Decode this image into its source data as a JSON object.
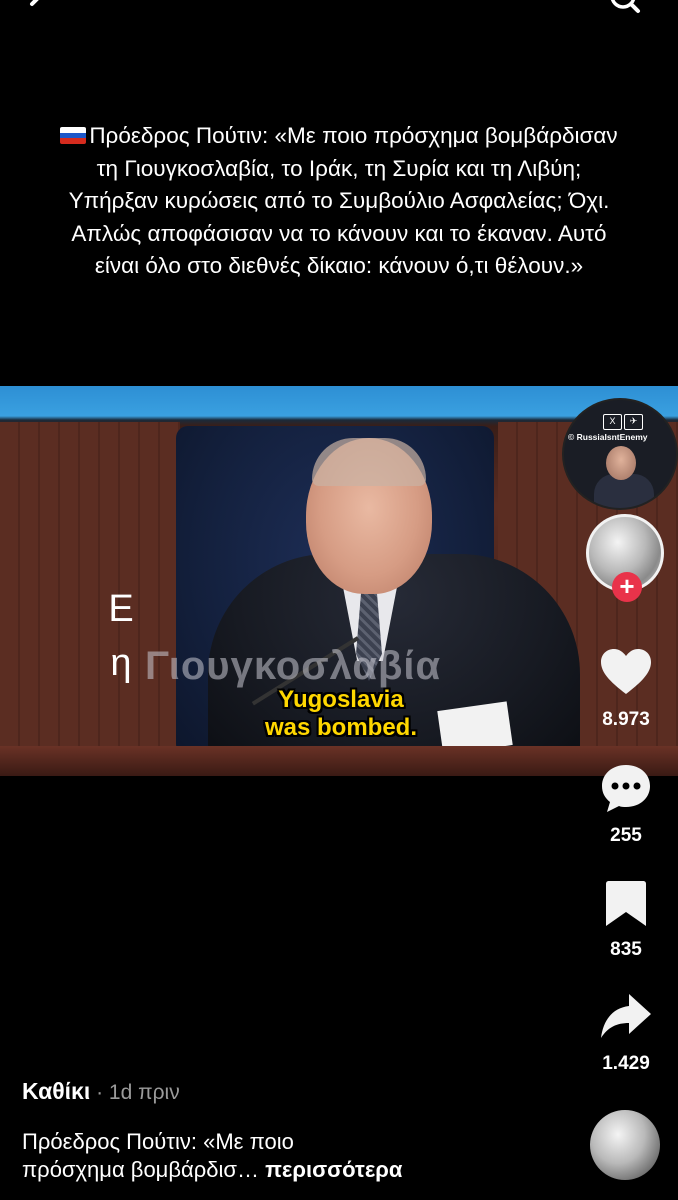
{
  "caption": {
    "flag_colors": [
      "#ffffff",
      "#1c57c9",
      "#d52b1e"
    ],
    "lines": [
      "Πρόεδρος Πούτιν: «Με ποιο πρόσχημα βομβάρδισαν",
      "τη Γιουγκοσλαβία, το Ιράκ, τη Συρία και τη Λιβύη;",
      "Υπήρξαν κυρώσεις από το Συμβούλιο Ασφαλείας; Όχι.",
      "Απλώς αποφάσισαν να το κάνουν και το έκαναν. Αυτό",
      "είναι όλο στο διεθνές δίκαιο: κάνουν ό,τι θέλουν.»"
    ]
  },
  "video": {
    "watermark": "Γιουγκοσλαβία",
    "side_letters": [
      "Ε",
      "η"
    ],
    "subtitle_line1": "Yugoslavia",
    "subtitle_line2": "was bombed.",
    "subtitle_color": "#ffd700"
  },
  "inset": {
    "logos": [
      "X",
      "✈"
    ],
    "handle": "© RussiaIsntEnemy"
  },
  "rail": {
    "follow_symbol": "+",
    "follow_color": "#e9334a",
    "likes": "8.973",
    "comments": "255",
    "saves": "835",
    "shares": "1.429",
    "icons": [
      "heart-icon",
      "comment-icon",
      "bookmark-icon",
      "share-icon"
    ]
  },
  "post": {
    "author": "Καθίκι",
    "meta": " · 1d πριν",
    "description_line1": "Πρόεδρος Πούτιν: «Με ποιο",
    "description_line2": "πρόσχημα βομβάρδισ… ",
    "more": "περισσότερα"
  }
}
